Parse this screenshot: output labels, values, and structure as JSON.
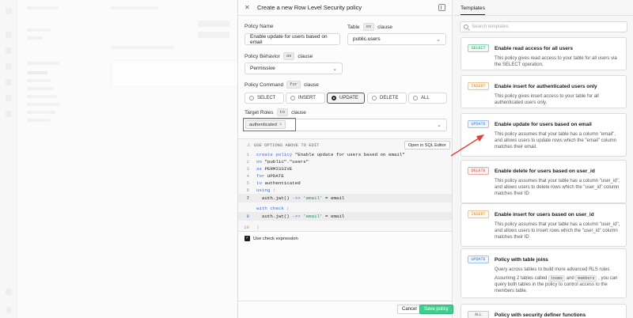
{
  "editor": {
    "title": "Create a new Row Level Security policy",
    "policy_name_label": "Policy Name",
    "policy_name_value": "Enable update for users based on email",
    "table_label": "Table",
    "table_chip": "on",
    "table_suffix": "clause",
    "table_value": "public.users",
    "behavior_label": "Policy Behavior",
    "behavior_chip": "as",
    "behavior_suffix": "clause",
    "behavior_value": "Permissive",
    "command_label": "Policy Command",
    "command_chip": "for",
    "command_suffix": "clause",
    "commands": [
      "SELECT",
      "INSERT",
      "UPDATE",
      "DELETE",
      "ALL"
    ],
    "selected_command": "UPDATE",
    "roles_label": "Target Roles",
    "roles_chip": "to",
    "roles_suffix": "clause",
    "role_tag": "authenticated",
    "role_tag_remove": "×",
    "code_note": "USE OPTIONS ABOVE TO EDIT",
    "open_sql_label": "Open in SQL Editor",
    "code": {
      "l1_kw1": "create",
      "l1_kw2": "policy",
      "l1_str": "\"Enable update for users based on email\"",
      "l2_kw": "on",
      "l2_str": "\"public\".\"users\"",
      "l3_kw": "as",
      "l3_txt": "PERMISSIVE",
      "l4_kw": "for",
      "l4_txt": "UPDATE",
      "l5_kw": "to",
      "l5_txt": "authenticated",
      "l6_kw": "using",
      "l6_txt": "(",
      "l7_fn": "auth.jwt()",
      "l7_op": "->>",
      "l7_str": "'email'",
      "l7_rest": "= email",
      "l8_kw": "with check",
      "l8_txt": "(",
      "l9_fn": "auth.jwt()",
      "l9_op": "->>",
      "l9_str": "'email'",
      "l9_rest": "= email",
      "l10_txt": ")"
    },
    "check_label": "Use check expression",
    "cancel_label": "Cancel",
    "save_label": "Save policy"
  },
  "templates": {
    "tab_label": "Templates",
    "search_placeholder": "Search templates",
    "items": [
      {
        "badge": "SELECT",
        "title": "Enable read access for all users",
        "desc": "This policy gives read access to your table for all users via the SELECT operation."
      },
      {
        "badge": "INSERT",
        "title": "Enable insert for authenticated users only",
        "desc": "This policy gives insert access to your table for all authenticated users only."
      },
      {
        "badge": "UPDATE",
        "title": "Enable update for users based on email",
        "desc": "This policy assumes that your table has a column \"email\", and allows users to update rows which the \"email\" column matches their email."
      },
      {
        "badge": "DELETE",
        "title": "Enable delete for users based on user_id",
        "desc": "This policy assumes that your table has a column \"user_id\", and allows users to delete rows which the \"user_id\" column matches their ID"
      },
      {
        "badge": "INSERT",
        "title": "Enable insert for users based on user_id",
        "desc": "This policy assumes that your table has a column \"user_id\", and allows users to insert rows which the \"user_id\" column matches their ID"
      },
      {
        "badge": "UPDATE",
        "title": "Policy with table joins",
        "desc1": "Query across tables to build more advanced RLS rules",
        "desc2a": "Assuming 2 tables called",
        "code_a": "teams",
        "desc2b": "and",
        "code_b": "members",
        "desc2c": ", you can query both tables in the policy to control access to the members table."
      },
      {
        "badge": "ALL",
        "title": "Policy with security definer functions"
      }
    ]
  },
  "colors": {
    "accent_green": "#3ecf8e",
    "annotation_red": "#e0413a"
  }
}
